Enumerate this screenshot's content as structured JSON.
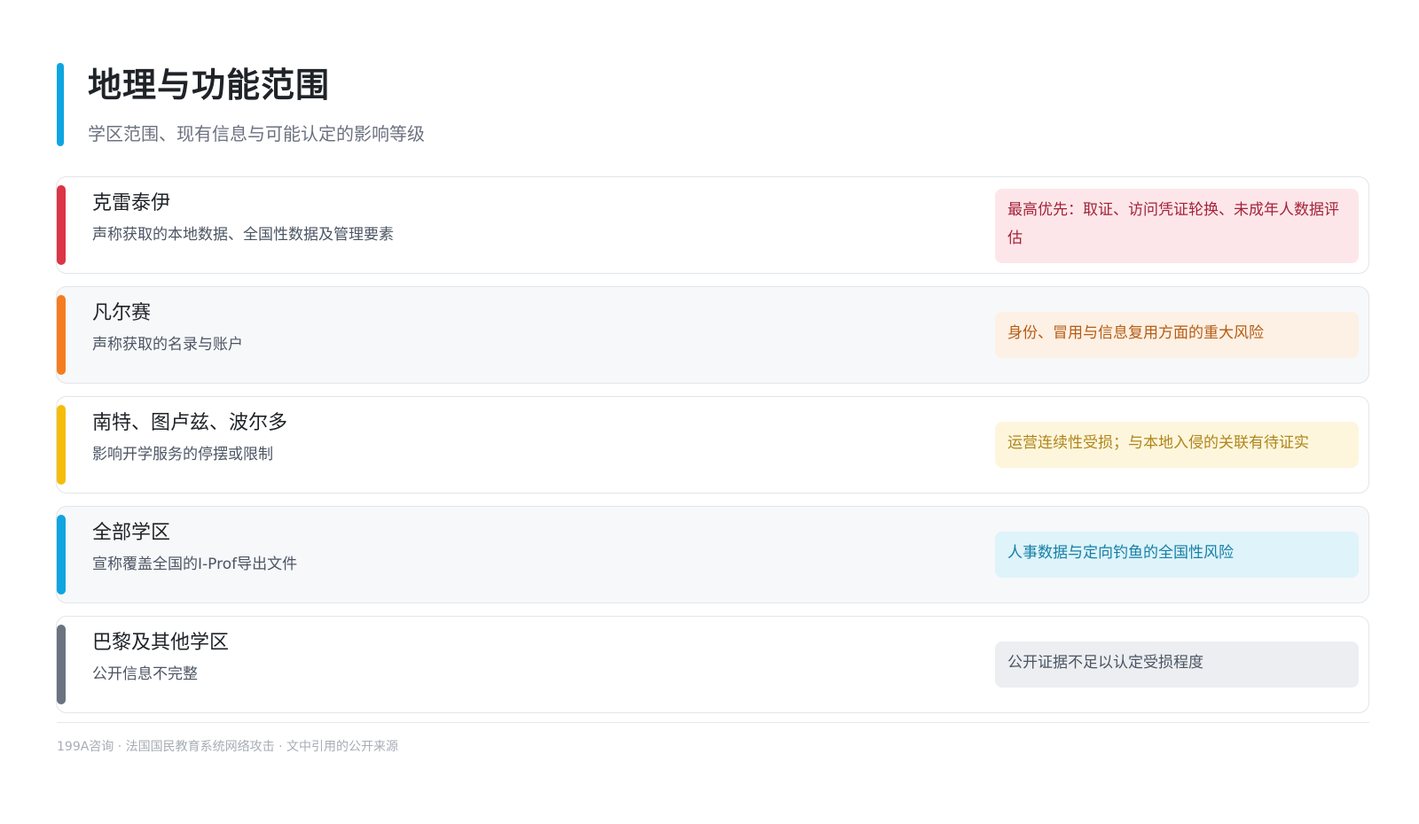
{
  "header": {
    "title": "地理与功能范围",
    "subtitle": "学区范围、现有信息与可能认定的影响等级",
    "accent": "#0ea5e0"
  },
  "rows": [
    {
      "title": "克雷泰伊",
      "desc": "声称获取的本地数据、全国性数据及管理要素",
      "badge": "最高优先：取证、访问凭证轮换、未成年人数据评估",
      "bar_color": "#dc3545",
      "badge_bg": "#fde6e9",
      "badge_fg": "#a4233a"
    },
    {
      "title": "凡尔赛",
      "desc": "声称获取的名录与账户",
      "badge": "身份、冒用与信息复用方面的重大风险",
      "bar_color": "#f57c1f",
      "badge_bg": "#fdf0e4",
      "badge_fg": "#b55d14"
    },
    {
      "title": "南特、图卢兹、波尔多",
      "desc": "影响开学服务的停摆或限制",
      "badge": "运营连续性受损；与本地入侵的关联有待证实",
      "bar_color": "#f5bd0a",
      "badge_bg": "#fdf6dd",
      "badge_fg": "#b0861a"
    },
    {
      "title": "全部学区",
      "desc": "宣称覆盖全国的I-Prof导出文件",
      "badge": "人事数据与定向钓鱼的全国性风险",
      "bar_color": "#0ea5e0",
      "badge_bg": "#def3fa",
      "badge_fg": "#157fa6"
    },
    {
      "title": "巴黎及其他学区",
      "desc": "公开信息不完整",
      "badge": "公开证据不足以认定受损程度",
      "bar_color": "#6b7280",
      "badge_bg": "#eceef1",
      "badge_fg": "#4b5563"
    }
  ],
  "footer": {
    "text": "199A咨询 · 法国国民教育系统网络攻击 · 文中引用的公开来源"
  }
}
